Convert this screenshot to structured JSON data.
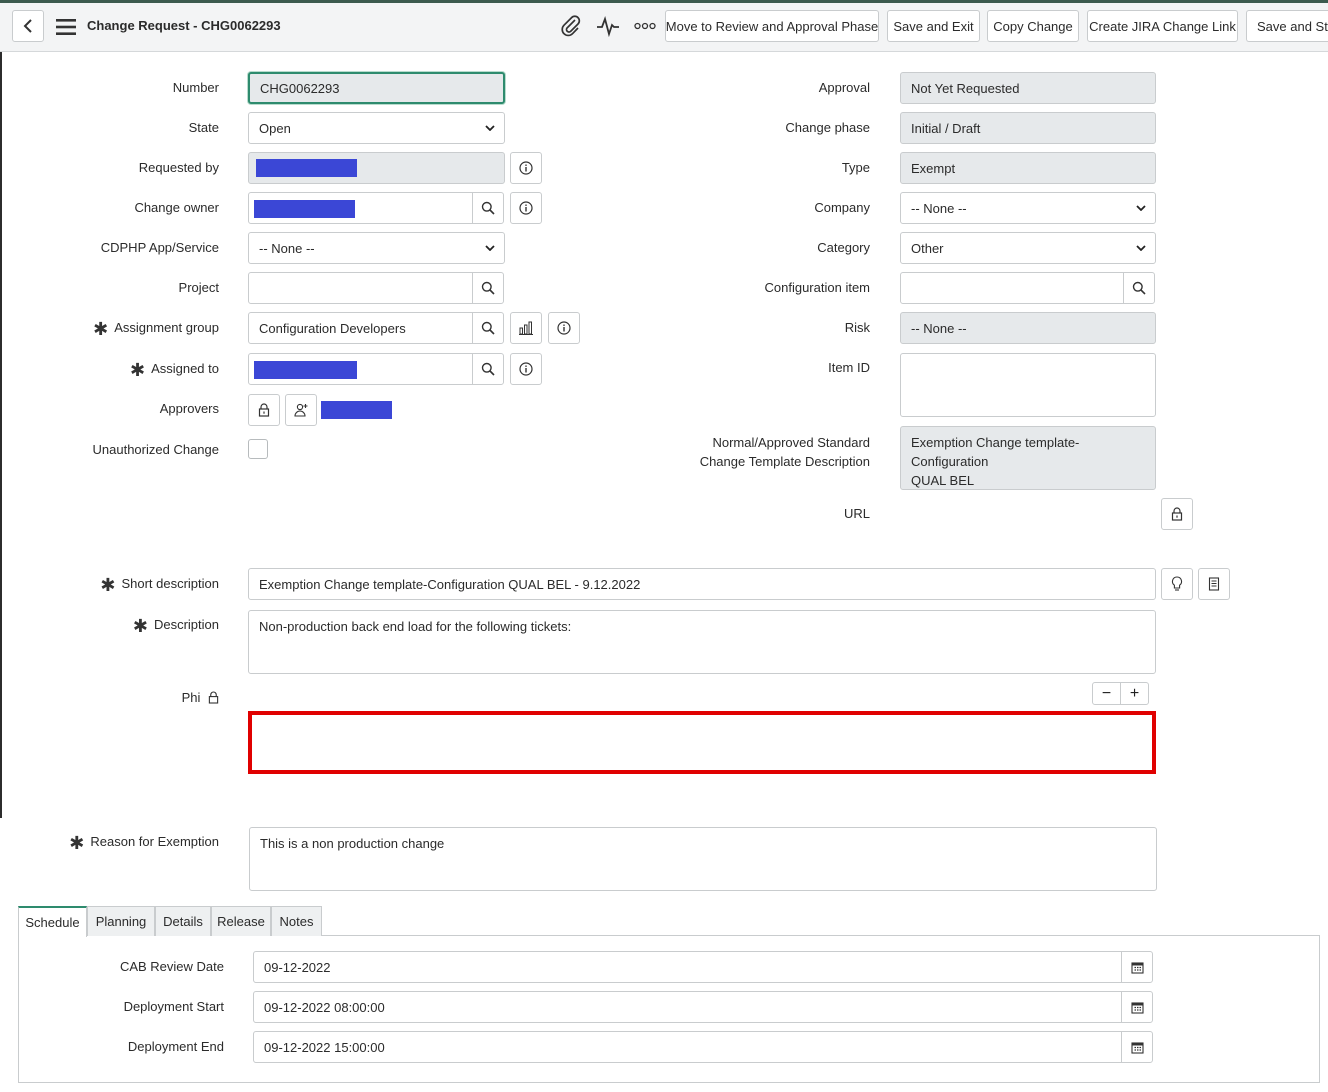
{
  "header": {
    "title": "Change Request - CHG0062293",
    "buttons": {
      "move": "Move to Review and Approval Phase",
      "save_exit": "Save and Exit",
      "copy": "Copy Change",
      "jira": "Create JIRA Change Link",
      "save_stay": "Save and Stay"
    }
  },
  "left": {
    "number": {
      "label": "Number",
      "value": "CHG0062293"
    },
    "state": {
      "label": "State",
      "value": "Open"
    },
    "requested_by": {
      "label": "Requested by"
    },
    "change_owner": {
      "label": "Change owner"
    },
    "app_service": {
      "label": "CDPHP App/Service",
      "value": "-- None --"
    },
    "project": {
      "label": "Project",
      "value": ""
    },
    "assignment_group": {
      "label": "Assignment group",
      "value": "Configuration Developers"
    },
    "assigned_to": {
      "label": "Assigned to"
    },
    "approvers": {
      "label": "Approvers"
    },
    "unauthorized": {
      "label": "Unauthorized Change"
    }
  },
  "right": {
    "approval": {
      "label": "Approval",
      "value": "Not Yet Requested"
    },
    "change_phase": {
      "label": "Change phase",
      "value": "Initial / Draft"
    },
    "type": {
      "label": "Type",
      "value": "Exempt"
    },
    "company": {
      "label": "Company",
      "value": "-- None --"
    },
    "category": {
      "label": "Category",
      "value": "Other"
    },
    "config_item": {
      "label": "Configuration item",
      "value": ""
    },
    "risk": {
      "label": "Risk",
      "value": "-- None --"
    },
    "item_id": {
      "label": "Item ID",
      "value": ""
    },
    "template_desc": {
      "label_line1": "Normal/Approved Standard",
      "label_line2": "Change Template Description",
      "value": "Exemption Change template-Configuration\nQUAL BEL"
    },
    "url": {
      "label": "URL"
    }
  },
  "short_description": {
    "label": "Short description",
    "value": "Exemption Change template-Configuration QUAL BEL - 9.12.2022"
  },
  "description": {
    "label": "Description",
    "value": "Non-production back end load for the following tickets:"
  },
  "phi": {
    "label": "Phi",
    "minus": "−",
    "plus": "+"
  },
  "reason": {
    "label": "Reason for Exemption",
    "value": "This is a non production change"
  },
  "tabs": [
    "Schedule",
    "Planning",
    "Details",
    "Release",
    "Notes"
  ],
  "schedule": {
    "cab_review": {
      "label": "CAB Review Date",
      "value": "09-12-2022"
    },
    "deploy_start": {
      "label": "Deployment Start",
      "value": "09-12-2022 08:00:00"
    },
    "deploy_end": {
      "label": "Deployment End",
      "value": "09-12-2022 15:00:00"
    }
  },
  "colors": {
    "redaction": "#3b47d6",
    "highlight": "#e00000",
    "accent": "#2e8b6e"
  }
}
